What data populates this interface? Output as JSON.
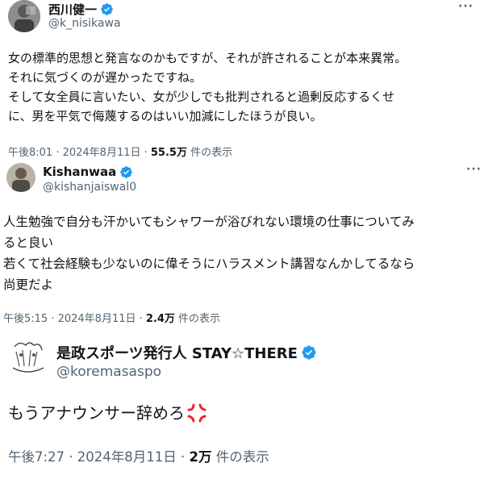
{
  "posts": [
    {
      "name": "西川健一",
      "handle": "@k_nisikawa",
      "more": "···",
      "lines": [
        "女の標準的思想と発言なのかもですが、それが許されることが本来異常。",
        "それに気づくのが遅かったですね。",
        "そして女全員に言いたい、女が少しでも批判されると過剰反応するくせ",
        "に、男を平気で侮蔑するのはいい加減にしたほうが良い。"
      ],
      "time": "午後8:01 · 2024年8月11日 · ",
      "views": "55.5万",
      "views_suffix": " 件の表示"
    },
    {
      "name": "Kishanwaa",
      "handle": "@kishanjaiswal0",
      "more": "···",
      "lines": [
        "人生勉強で自分も汗かいてもシャワーが浴びれない環境の仕事についてみ",
        "ると良い",
        "若くて社会経験も少ないのに偉そうにハラスメント講習なんかしてるなら",
        "尚更だよ"
      ],
      "time": "午後5:15 · 2024年8月11日 · ",
      "views": "2.4万",
      "views_suffix": " 件の表示"
    },
    {
      "name": "是政スポーツ発行人 STAY☆THERE",
      "handle": "@koremasaspo",
      "lines": [
        "もうアナウンサー辞めろ"
      ],
      "time": "午後7:27 · 2024年8月11日 · ",
      "views": "2万",
      "views_suffix": " 件の表示"
    }
  ],
  "colors": {
    "text": "#0f1419",
    "secondary": "#536471",
    "verified": "#1d9bf0",
    "anger": "#f4212e"
  },
  "icons": [
    "verified-badge-icon",
    "more-options-icon",
    "anger-symbol-icon"
  ]
}
